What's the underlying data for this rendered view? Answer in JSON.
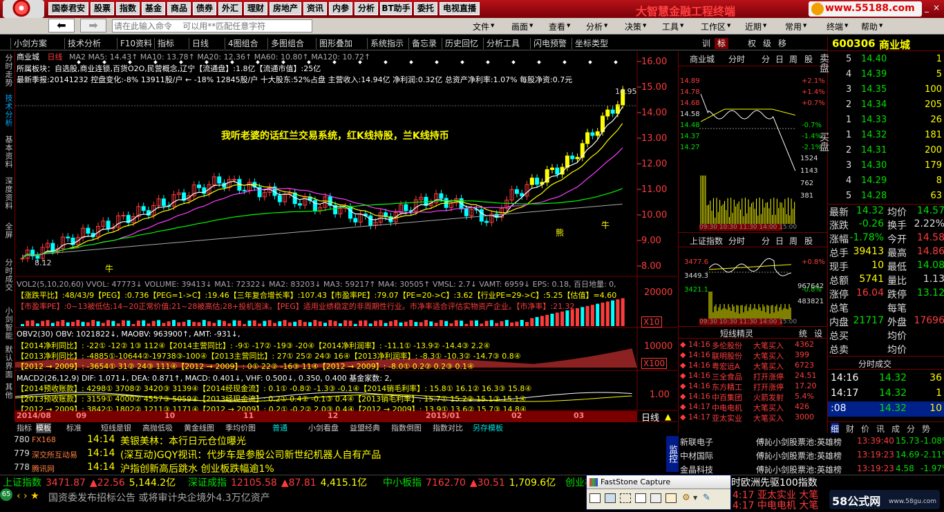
{
  "titlebar": {
    "buttons": [
      "国泰君安",
      "股票",
      "指数",
      "基金",
      "商品",
      "债券",
      "外汇",
      "理财",
      "房地产",
      "资讯",
      "内参",
      "分析",
      "BT助手",
      "委托",
      "电视直播"
    ],
    "app_title": "大智慧金融工程终端",
    "logo_text": "www.55188.com"
  },
  "toolbar2": {
    "command_placeholder": "请在此输入命令    可以用**匹配任意字符",
    "menus": [
      "文件",
      "画面",
      "查看",
      "分析",
      "决策",
      "工具",
      "工作区",
      "近期",
      "常用",
      "终端",
      "帮助"
    ]
  },
  "menubar": {
    "items": [
      "小剑方案",
      "技术分析",
      "F10资料",
      "指标",
      "日线",
      "4图组合",
      "多图组合",
      "图形叠加",
      "系统指示",
      "备忘录",
      "历史回忆",
      "分析工具",
      "闪电预警",
      "坐标类型"
    ],
    "right_items": [
      "训",
      "标",
      "",
      "权",
      "级",
      "移",
      "",
      "",
      ""
    ]
  },
  "leftnav": [
    "分时走势",
    "技术分析",
    "基本资料",
    "深度资料",
    "全屏",
    "分时成交",
    "小剑智能",
    "默认界面",
    "其他"
  ],
  "chart": {
    "stock_name": "商业城",
    "period": "日线",
    "ma_line": "MA2  MA5: 14.43↑ MA10: 13.78↑ MA20: 12.36↑ MA60: 10.80↑ MA120: 10.72↑",
    "info1": "所属板块：自选股,商业连锁,百货O2O,民营概念,辽宁【流通盘】:1.8亿【流通市值】:25亿",
    "info2": "最新季报:20141232 控盘变化:-8% 13911股/户 ←  -18% 12845股/户 十大股东:52%占盘 主营收入:14.94亿 净利润:0.32亿 总资产净利率:1.07% 每股净资:0.7元",
    "annotation": "我听老婆的话红兰交易系统，红K线持股，兰K线持币",
    "price_labels": [
      "16.00",
      "15.00",
      "14.00",
      "13.00",
      "12.00",
      "11.00",
      "10.00",
      "9.00",
      "8.00"
    ],
    "last_price_mark": "14.95",
    "low_mark": "8.12",
    "label_bear": "熊",
    "label_bull": "牛",
    "label_bull2": "牛",
    "vol_line": "VOL2(5,10,20,60) VVOL: 47773↓ VOLUME: 39413↓ MA1: 72322↓ MA2: 83203↓ MA3: 59217↑ MA4: 30505↑ VMSL: 2.7↓ VAMT: 6959↓ EPS: 0.18, 百日地量: 0,",
    "vol_row2": "【涨跌平比】:48/43/9【PEG】:0.736【PEG=1->C】:19.46【三年复合增长率】:107.43【市盈率PE】:79.07【PE=20->C】:3.62【行业PE=29->C】:5.25【估值】=4.60",
    "vol_row3": "【市盈率PE】:0~13被低估;14~20正常价值;21~28被高估;28+投机泡沫。【PEG】适用业绩稳定的非周期性行业。市净率适合评估实物资产企业。【市净率】:21.32",
    "vol_axis": "20000",
    "vol_x10": "X10",
    "obv_line": "OBV2(30) OBV: 1021822↓, MAOBV: 963900↑, AMT: -931↓,",
    "obv_row1": "【2014净利同比】: -22① -12② 1③ 112④【2014主营同比】: -9① -17② -19③ -20④【2014净利润率】: -11.1① -13.9② -14.4③ 2.2④",
    "obv_row2": "【2013净利同比】: -4885①-10644②-19738③-100④【2013主营同比】: 27① 25② 24③ 16④【2013净利润率】: -8.3① -10.3② -14.7③ 0.8④",
    "obv_row3": "【2012 → 2009】: -3654① 31② 24③ 111④【2012 → 2009】: 0① 22② -16③ 11④【2012 → 2009】: -8.0① 0.2② 0.2③ 0.1④",
    "obv_axis": "10000",
    "obv_x100": "X100",
    "macd_line": "MACD2(26,12,9) DIF: 1.071↓, DEA: 0.871↑, MACD: 0.401↓, VHF: 0.500↓, 0.350, 0.400 基金家数: 2,",
    "macd_row1": "【2014预收账款】: 4298① 3708② 3420③ 3139④【2014经现金流】: 0.1① -0.8② -1.3③ -0.1④【2014销毛利率】: 15.8① 16.1② 16.3③ 15.8④",
    "macd_row2": "【2013预收账款】: 3159① 4000② 4557③ 5059④【2013经现金流】: 0.2① 0.4② -0.1③ 0.4④【2013销毛利率】: 15.7① 15.2② 15.1③ 15.1④",
    "macd_row3": "【2012 → 2009】: 3842① 1802② 1211③ 1171④【2012 → 2009】: 0.2① -0.2② 2.0③ 0.4④【2012 → 2009】: 13.9① 13.6② 15.7③ 14.8④",
    "macd_axis": "1.00",
    "date_axis": [
      "2014/08",
      "09",
      "10",
      "11",
      "12",
      "2015/01",
      "02",
      "03"
    ],
    "period_label": "日线"
  },
  "bottom_tabs": [
    "指标",
    "模板",
    "标准",
    "短线是银",
    "高抛低吸",
    "黄金线图",
    "季均价图",
    "普通",
    "小剑看盘",
    "益盟经典",
    "指数倒图",
    "指数对比",
    "另存模板"
  ],
  "minichart1": {
    "tabs": [
      "商业城",
      "分时",
      "分",
      "日",
      "周",
      "股"
    ],
    "prices": [
      "14.89",
      "14.78",
      "14.68",
      "14.58",
      "14.48",
      "14.37",
      "14.27"
    ],
    "pcts": [
      "+2.1%",
      "+1.4%",
      "+0.7%",
      "",
      "-0.7%",
      "-1.4%",
      "-2.1%"
    ],
    "vols": [
      "1524",
      "1143",
      "762",
      "381"
    ],
    "times": "09:30 10:30 11:30 14:00 15:00"
  },
  "minichart2": {
    "tabs": [
      "上证指数",
      "分时",
      "分",
      "日",
      "周",
      "股"
    ],
    "prices": [
      "3477.6",
      "3449.3",
      "3421.1"
    ],
    "pcts": [
      "+0.8%",
      "",
      "-0.8%"
    ],
    "vols": [
      "967642",
      "483821"
    ],
    "times": "09:30 10:30 11:30 14:00 15:00"
  },
  "shortline": {
    "title": "短线精灵",
    "tabs": [
      "统",
      "设"
    ],
    "rows": [
      {
        "time": "14:16",
        "name": "多伦股份",
        "event": "大笔买入",
        "val": "4362"
      },
      {
        "time": "14:16",
        "name": "联明股份",
        "event": "大笔买入",
        "val": "399"
      },
      {
        "time": "14:16",
        "name": "粤宏远A",
        "event": "大笔买入",
        "val": "6723"
      },
      {
        "time": "14:16",
        "name": "三全食品",
        "event": "打开涨停",
        "val": "24.51"
      },
      {
        "time": "14:16",
        "name": "东方精工",
        "event": "打开涨停",
        "val": "17.20"
      },
      {
        "time": "14:16",
        "name": "中百集团",
        "event": "火箭发射",
        "val": "5.4%"
      },
      {
        "time": "14:17",
        "name": "中电电机",
        "event": "大笔买入",
        "val": "426"
      },
      {
        "time": "14:17",
        "name": "亚太实业",
        "event": "大笔买入",
        "val": "3000"
      }
    ]
  },
  "quote": {
    "code": "600306",
    "name": "商业城",
    "sell_label": "卖盘",
    "buy_label": "买盘",
    "sells": [
      {
        "lv": "5",
        "price": "14.40",
        "vol": "1"
      },
      {
        "lv": "4",
        "price": "14.39",
        "vol": "5"
      },
      {
        "lv": "3",
        "price": "14.35",
        "vol": "100"
      },
      {
        "lv": "2",
        "price": "14.34",
        "vol": "205"
      },
      {
        "lv": "1",
        "price": "14.33",
        "vol": "26"
      }
    ],
    "buys": [
      {
        "lv": "1",
        "price": "14.32",
        "vol": "181"
      },
      {
        "lv": "2",
        "price": "14.31",
        "vol": "200"
      },
      {
        "lv": "3",
        "price": "14.30",
        "vol": "179"
      },
      {
        "lv": "4",
        "price": "14.29",
        "vol": "8"
      },
      {
        "lv": "5",
        "price": "14.28",
        "vol": "63"
      }
    ],
    "stats": [
      {
        "k1": "最新",
        "v1": "14.32",
        "k2": "均价",
        "v2": "14.57"
      },
      {
        "k1": "涨跌",
        "v1": "-0.26",
        "k2": "换手",
        "v2": "2.22%"
      },
      {
        "k1": "涨幅",
        "v1": "-1.78%",
        "k2": "今开",
        "v2": "14.58"
      },
      {
        "k1": "总手",
        "v1": "39413",
        "k2": "最高",
        "v2": "14.86"
      },
      {
        "k1": "现手",
        "v1": "10",
        "k2": "最低",
        "v2": "14.08"
      },
      {
        "k1": "总额",
        "v1": "5741",
        "k2": "量比",
        "v2": "1.13"
      },
      {
        "k1": "涨停",
        "v1": "16.04",
        "k2": "跌停",
        "v2": "13.12"
      },
      {
        "k1": "总笔",
        "v1": "",
        "k2": "每笔",
        "v2": ""
      },
      {
        "k1": "内盘",
        "v1": "21717",
        "k2": "外盘",
        "v2": "17696"
      },
      {
        "k1": "总买",
        "v1": "",
        "k2": "均价",
        "v2": ""
      },
      {
        "k1": "总卖",
        "v1": "",
        "k2": "均价",
        "v2": ""
      }
    ],
    "ticks_title": "分时成交",
    "ticks": [
      {
        "t": "14:16",
        "p": "14.32",
        "v": "36"
      },
      {
        "t": "14:17",
        "p": "14.32",
        "v": "1"
      },
      {
        "t": ":08",
        "p": "14.32",
        "v": "10"
      }
    ],
    "bottom_tabs": [
      "细",
      "财",
      "价",
      "讯",
      "成",
      "分",
      "势"
    ]
  },
  "news": [
    {
      "code": "780",
      "src": "FX168",
      "time": "14:14",
      "title": "美银美林：本行日元仓位曝光"
    },
    {
      "code": "779",
      "src": "深交所互动易",
      "time": "14:14",
      "title": "(深互动)GQY视讯：代步车是参股公司新世纪机器人自有产品"
    },
    {
      "code": "778",
      "src": "腾讯网",
      "time": "14:14",
      "title": "沪指创新高后跳水 创业板跌幅逾1%"
    }
  ],
  "news_right": {
    "side_label": "监控",
    "rows": [
      {
        "name": "新联电子",
        "src": "傅訫小剑股票池:英雄榜",
        "time": "13:39:40",
        "price": "15.73",
        "pct": "-1.08%"
      },
      {
        "name": "中材国际",
        "src": "傅訫小剑股票池:英雄榜",
        "time": "13:19:23",
        "price": "14.69",
        "pct": "-2.11%"
      },
      {
        "name": "金晶科技",
        "src": "傅訫小剑股票池:英雄榜",
        "time": "13:19:23",
        "price": "4.58",
        "pct": "-1.97%"
      }
    ]
  },
  "ticker": [
    {
      "name": "上证指数",
      "val": "3471.87",
      "chg": "▲22.56",
      "amt": "5,144.2亿"
    },
    {
      "name": "深证成指",
      "val": "12105.58",
      "chg": "▲87.81",
      "amt": "4,415.1亿"
    },
    {
      "name": "中小板指",
      "val": "7162.70",
      "chg": "▲30.51",
      "amt": "1,709.6亿"
    },
    {
      "name": "创业板指",
      "val": "",
      "chg": "",
      "amt": ""
    }
  ],
  "ticker_tail": "时欧洲先驱100指数",
  "statusbar": {
    "badge": "65",
    "text": "国资委发布招标公告 或将审计央企境外4.3万亿资产",
    "right1": "4:17 亚太实业 大笔",
    "right2": "4:17 中电电机 大笔",
    "watermark": "58公式网",
    "watermark_url": "www.58gu.com"
  },
  "faststone": {
    "title": "FastStone Capture"
  },
  "colors": {
    "up": "#ff3c3c",
    "down": "#00ffff",
    "title_red": "#b8121a",
    "border": "#7a0000"
  }
}
